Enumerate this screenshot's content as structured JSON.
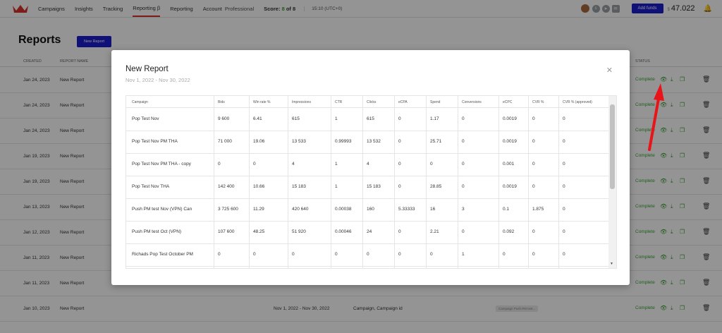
{
  "nav": {
    "items": [
      "Campaigns",
      "Insights",
      "Tracking",
      "Reporting β",
      "Reporting",
      "Account"
    ],
    "account_level": "Professional",
    "score_label": "Score:",
    "score_value": "8",
    "score_of": "of",
    "score_total": "8",
    "time": "15:10 (UTC+0)",
    "add_funds": "Add funds",
    "currency_symbol": "$",
    "balance": "47.022"
  },
  "page": {
    "title": "Reports",
    "new_report_button": "New Report",
    "columns": {
      "created": "CREATED",
      "report_name": "REPORT NAME",
      "status": "STATUS"
    },
    "rows": [
      {
        "created": "Jan 24, 2023",
        "name": "New Report",
        "status": "Complete"
      },
      {
        "created": "Jan 24, 2023",
        "name": "New Report",
        "status": "Complete"
      },
      {
        "created": "Jan 24, 2023",
        "name": "New Report",
        "status": "Complete"
      },
      {
        "created": "Jan 19, 2023",
        "name": "New Report",
        "status": "Complete"
      },
      {
        "created": "Jan 19, 2023",
        "name": "New Report",
        "status": "Complete"
      },
      {
        "created": "Jan 13, 2023",
        "name": "New Report",
        "status": "Complete"
      },
      {
        "created": "Jan 12, 2023",
        "name": "New Report",
        "status": "Complete"
      },
      {
        "created": "Jan 11, 2023",
        "name": "New Report",
        "status": "Complete"
      },
      {
        "created": "Jan 11, 2023",
        "name": "New Report",
        "status": "Complete"
      },
      {
        "created": "Jan 10, 2023",
        "name": "New Report",
        "status": "Complete",
        "period": "Nov 1, 2022 - Nov 30, 2022",
        "group": "Campaign, Campaign id",
        "tag": "Campaign Push PM test..."
      }
    ]
  },
  "modal": {
    "title": "New Report",
    "subtitle": "Nov 1, 2022 - Nov 30, 2022",
    "columns": [
      "Campaign",
      "Bids",
      "Win rate %",
      "Impressions",
      "CTR",
      "Clicks",
      "eCPA",
      "Spend",
      "Conversions",
      "eCPC",
      "CVR %",
      "CVR % (approved)"
    ],
    "rows": [
      [
        "Pop Test Nov",
        "9 600",
        "6.41",
        "615",
        "1",
        "615",
        "0",
        "1.17",
        "0",
        "0.0019",
        "0",
        "0"
      ],
      [
        "Pop Test Nov PM THA",
        "71 000",
        "19.06",
        "13 533",
        "0.99993",
        "13 532",
        "0",
        "25.71",
        "0",
        "0.0019",
        "0",
        "0"
      ],
      [
        "Pop Test Nov PM THA - copy",
        "0",
        "0",
        "4",
        "1",
        "4",
        "0",
        "0",
        "0",
        "0.001",
        "0",
        "0"
      ],
      [
        "Pop Test Nov THA",
        "142 400",
        "10.66",
        "15 183",
        "1",
        "15 183",
        "0",
        "28.85",
        "0",
        "0.0019",
        "0",
        "0"
      ],
      [
        "Push PM test Nov (VPN) Can",
        "3 725 600",
        "11.29",
        "420 640",
        "0.00038",
        "160",
        "5.33333",
        "16",
        "3",
        "0.1",
        "1.875",
        "0"
      ],
      [
        "Push PM test Oct (VPN)",
        "107 600",
        "48.25",
        "51 920",
        "0.00046",
        "24",
        "0",
        "2.21",
        "0",
        "0.092",
        "0",
        "0"
      ],
      [
        "Richads Pop Test October PM",
        "0",
        "0",
        "0",
        "0",
        "0",
        "0",
        "0",
        "1",
        "0",
        "0",
        "0"
      ]
    ]
  },
  "colors": {
    "accent": "#1d1cd0",
    "success": "#3aa335",
    "annotation_arrow": "#e8141a"
  }
}
